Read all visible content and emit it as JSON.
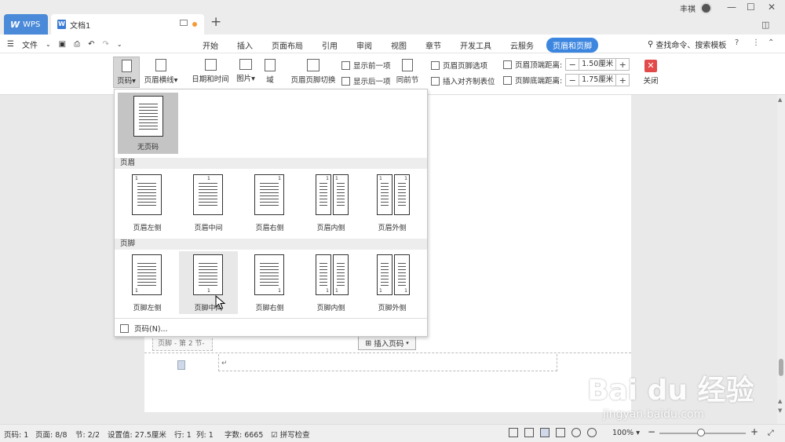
{
  "titlebar": {
    "app_tab": "WPS",
    "doc_tab": "文档1",
    "doc_icon_letter": "W",
    "user": "丰祺"
  },
  "menubar": {
    "file": "文件",
    "tabs": [
      "开始",
      "插入",
      "页面布局",
      "引用",
      "审阅",
      "视图",
      "章节",
      "开发工具",
      "云服务",
      "页眉和页脚"
    ],
    "active_tab": "页眉和页脚",
    "search": "查找命令、搜索模板"
  },
  "toolbar": {
    "page_number": "页码",
    "header_line": "页眉横线",
    "datetime": "日期和时间",
    "picture": "图片",
    "field": "域",
    "switch": "页眉页脚切换",
    "show_prev": "显示前一项",
    "show_next": "显示后一项",
    "same_as_prev": "同前节",
    "hf_options": "页眉页脚选项",
    "insert_align_tab": "插入对齐制表位",
    "header_top_label": "页眉顶端距离:",
    "header_top_value": "1.50厘米",
    "footer_bottom_label": "页脚底端距离:",
    "footer_bottom_value": "1.75厘米",
    "close": "关闭"
  },
  "dropdown": {
    "none": "无页码",
    "header_section": "页眉",
    "footer_section": "页脚",
    "header_options": [
      "页眉左侧",
      "页眉中间",
      "页眉右侧",
      "页眉内侧",
      "页眉外侧"
    ],
    "footer_options": [
      "页脚左侧",
      "页脚中间",
      "页脚右侧",
      "页脚内侧",
      "页脚外侧"
    ],
    "page_num_marker": "1",
    "more": "页码(N)..."
  },
  "document": {
    "footer_label": "页脚 - 第 2 节-",
    "insert_page_number": "插入页码",
    "para_mark": "↵"
  },
  "statusbar": {
    "page_code": "页码: 1",
    "pages": "页面: 8/8",
    "section": "节: 2/2",
    "setting": "设置值: 27.5厘米",
    "row": "行: 1",
    "col": "列: 1",
    "words": "字数: 6665",
    "spell": "拼写检查",
    "zoom": "100%"
  },
  "watermark": {
    "brand": "Bai du 经验",
    "url": "jingyan.baidu.com"
  },
  "colors": {
    "accent": "#3d86e0",
    "close": "#e24a4a"
  }
}
